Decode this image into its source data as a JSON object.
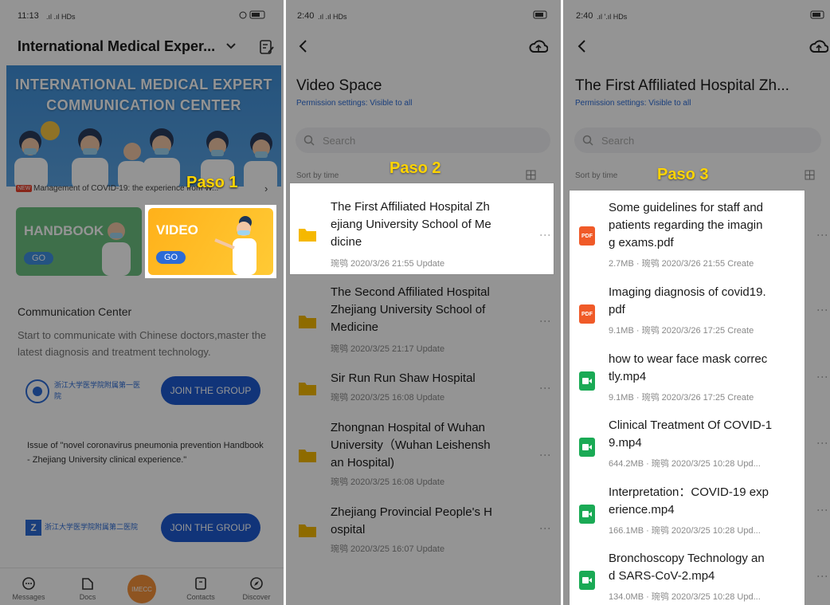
{
  "panel1": {
    "status_time": "11:13",
    "status_net": ".ıl .ıl HDs",
    "title": "International Medical Exper...",
    "banner_line1": "INTERNATIONAL MEDICAL EXPERT",
    "banner_line2": "COMMUNICATION CENTER",
    "news_badge": "NEW",
    "news_text": "Management of COVID-19:  the experience from W...",
    "handbook_label": "HANDBOOK",
    "handbook_go": "GO",
    "video_label": "VIDEO",
    "video_go": "GO",
    "paso": "Paso 1",
    "section_title": "Communication Center",
    "section_desc": "Start to communicate with Chinese doctors,master the latest diagnosis and treatment technology.",
    "group1_logo_text": "浙江大学医学院附属第一医院",
    "group1_button": "JOIN THE GROUP",
    "issue_text": "Issue of \"novel coronavirus pneumonia prevention Handbook - Zhejiang University clinical experience.\"",
    "group2_logo_text": "浙江大学医学院附属第二医院",
    "group2_button": "JOIN THE GROUP",
    "tabs": [
      {
        "label": "Messages",
        "icon": "chat-icon"
      },
      {
        "label": "Docs",
        "icon": "docs-icon"
      },
      {
        "label": "IMECC",
        "icon": "center-icon"
      },
      {
        "label": "Contacts",
        "icon": "contacts-icon"
      },
      {
        "label": "Discover",
        "icon": "compass-icon"
      }
    ]
  },
  "panel2": {
    "status_time": "2:40",
    "status_net": ".ıl .ıl HDs",
    "title": "Video Space",
    "permission": "Permission settings: Visible to all",
    "search_placeholder": "Search",
    "sort_label": "Sort by time",
    "paso": "Paso 2",
    "folders": [
      {
        "line1": "The First Affiliated Hospital Zh",
        "line2": "ejiang University School of Me",
        "line3": "dicine",
        "meta": "琬鸮 2020/3/26 21:55 Update"
      },
      {
        "line1": "The Second Affiliated Hospital",
        "line2": "Zhejiang University School of",
        "line3": "Medicine",
        "meta": "琬鸮 2020/3/25 21:17 Update"
      },
      {
        "line1": "Sir Run Run Shaw Hospital",
        "line2": "",
        "line3": "",
        "meta": "琬鸮 2020/3/25 16:08 Update"
      },
      {
        "line1": "Zhongnan Hospital of Wuhan",
        "line2": "University（Wuhan Leishensh",
        "line3": "an Hospital)",
        "meta": "琬鸮 2020/3/25 16:08 Update"
      },
      {
        "line1": "Zhejiang Provincial People's H",
        "line2": "ospital",
        "line3": "",
        "meta": "琬鸮 2020/3/25 16:07 Update"
      }
    ]
  },
  "panel3": {
    "status_time": "2:40",
    "status_net": ".ıl '.ıl HDs",
    "title": "The First Affiliated Hospital Zh...",
    "permission": "Permission settings: Visible to all",
    "search_placeholder": "Search",
    "sort_label": "Sort by time",
    "paso": "Paso 3",
    "files": [
      {
        "type": "pdf",
        "type_label": "PDF",
        "line1": "Some guidelines for staff and",
        "line2": "patients regarding the imagin",
        "line3": "g exams.pdf",
        "meta": "2.7MB · 琬鸮 2020/3/26 21:55 Create"
      },
      {
        "type": "pdf",
        "type_label": "PDF",
        "line1": "Imaging diagnosis of covid19.",
        "line2": "pdf",
        "line3": "",
        "meta": "9.1MB · 琬鸮 2020/3/26 17:25 Create"
      },
      {
        "type": "video",
        "type_label": "",
        "line1": "how to wear face mask correc",
        "line2": "tly.mp4",
        "line3": "",
        "meta": "9.1MB · 琬鸮 2020/3/26 17:25 Create"
      },
      {
        "type": "video",
        "type_label": "",
        "line1": "Clinical Treatment Of COVID-1",
        "line2": "9.mp4",
        "line3": "",
        "meta": "644.2MB · 琬鸮 2020/3/25 10:28 Upd..."
      },
      {
        "type": "video",
        "type_label": "",
        "line1": "Interpretation：COVID-19 exp",
        "line2": "erience.mp4",
        "line3": "",
        "meta": "166.1MB · 琬鸮 2020/3/25 10:28 Upd..."
      },
      {
        "type": "video",
        "type_label": "",
        "line1": "Bronchoscopy Technology an",
        "line2": "d SARS-CoV-2.mp4",
        "line3": "",
        "meta": "134.0MB · 琬鸮 2020/3/25 10:28 Upd..."
      }
    ]
  },
  "colors": {
    "accent": "#2c6bd6",
    "paso": "#ffd400",
    "pdf": "#f05a28",
    "video": "#1aaa55",
    "folder": "#f5b800"
  }
}
